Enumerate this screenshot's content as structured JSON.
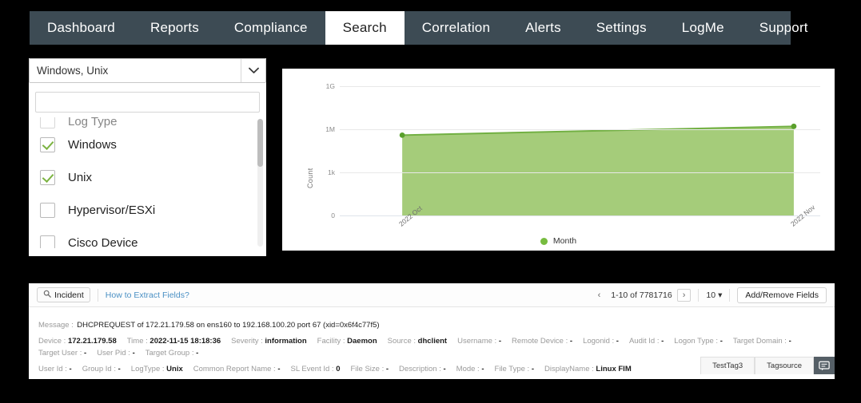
{
  "nav": {
    "items": [
      {
        "label": "Dashboard",
        "active": false
      },
      {
        "label": "Reports",
        "active": false
      },
      {
        "label": "Compliance",
        "active": false
      },
      {
        "label": "Search",
        "active": true
      },
      {
        "label": "Correlation",
        "active": false
      },
      {
        "label": "Alerts",
        "active": false
      },
      {
        "label": "Settings",
        "active": false
      },
      {
        "label": "LogMe",
        "active": false
      },
      {
        "label": "Support",
        "active": false
      }
    ]
  },
  "device_filter": {
    "selected_text": "Windows, Unix",
    "caret_icon": "chevron-down-icon",
    "search_value": "",
    "search_placeholder": "",
    "options": [
      {
        "label": "Windows",
        "checked": true
      },
      {
        "label": "Unix",
        "checked": true
      },
      {
        "label": "Hypervisor/ESXi",
        "checked": false
      },
      {
        "label": "Cisco Device",
        "checked": false
      }
    ]
  },
  "chart_data": {
    "type": "area",
    "title": "",
    "xlabel": "",
    "ylabel": "Count",
    "categories": [
      "2022 Oct",
      "2022 Nov"
    ],
    "values": [
      390000,
      1600000
    ],
    "series": [
      {
        "name": "Month",
        "values": [
          390000,
          1600000
        ]
      }
    ],
    "y_ticks": [
      "0",
      "1k",
      "1M",
      "1G"
    ],
    "y_scale": "log",
    "grid": true,
    "legend": {
      "position": "bottom",
      "entries": [
        "Month"
      ]
    },
    "colors": {
      "fill": "#a5cc7a",
      "line": "#72b043",
      "marker": "#5aa02c"
    }
  },
  "results": {
    "toolbar": {
      "incident_label": "Incident",
      "incident_icon": "incident-search-icon",
      "extract_fields_link": "How to Extract Fields?",
      "prev_icon": "chevron-left-icon",
      "next_icon": "chevron-right-icon",
      "page_range": "1-10 of 7781716",
      "page_size": "10",
      "page_size_caret": "caret-down-icon",
      "add_remove_label": "Add/Remove Fields"
    },
    "record": {
      "message_key": "Message",
      "message_value": "DHCPREQUEST of 172.21.179.58 on ens160 to 192.168.100.20 port 67 (xid=0x6f4c77f5)",
      "fields_row1": [
        {
          "key": "Device",
          "value": "172.21.179.58"
        },
        {
          "key": "Time",
          "value": "2022-11-15 18:18:36"
        },
        {
          "key": "Severity",
          "value": "information"
        },
        {
          "key": "Facility",
          "value": "Daemon"
        },
        {
          "key": "Source",
          "value": "dhclient"
        },
        {
          "key": "Username",
          "value": "-"
        },
        {
          "key": "Remote Device",
          "value": "-"
        },
        {
          "key": "Logonid",
          "value": "-"
        },
        {
          "key": "Audit Id",
          "value": "-"
        },
        {
          "key": "Logon Type",
          "value": "-"
        },
        {
          "key": "Target Domain",
          "value": "-"
        },
        {
          "key": "Target User",
          "value": "-"
        },
        {
          "key": "User Pid",
          "value": "-"
        },
        {
          "key": "Target Group",
          "value": "-"
        }
      ],
      "fields_row2": [
        {
          "key": "User Id",
          "value": "-"
        },
        {
          "key": "Group Id",
          "value": "-"
        },
        {
          "key": "LogType",
          "value": "Unix"
        },
        {
          "key": "Common Report Name",
          "value": "-"
        },
        {
          "key": "SL Event Id",
          "value": "0"
        },
        {
          "key": "File Size",
          "value": "-"
        },
        {
          "key": "Description",
          "value": "-"
        },
        {
          "key": "Mode",
          "value": "-"
        },
        {
          "key": "File Type",
          "value": "-"
        },
        {
          "key": "DisplayName",
          "value": "Linux FIM"
        }
      ]
    },
    "tags": [
      {
        "label": "TestTag3"
      },
      {
        "label": "Tagsource"
      }
    ],
    "chat_icon": "chat-bubble-icon"
  }
}
